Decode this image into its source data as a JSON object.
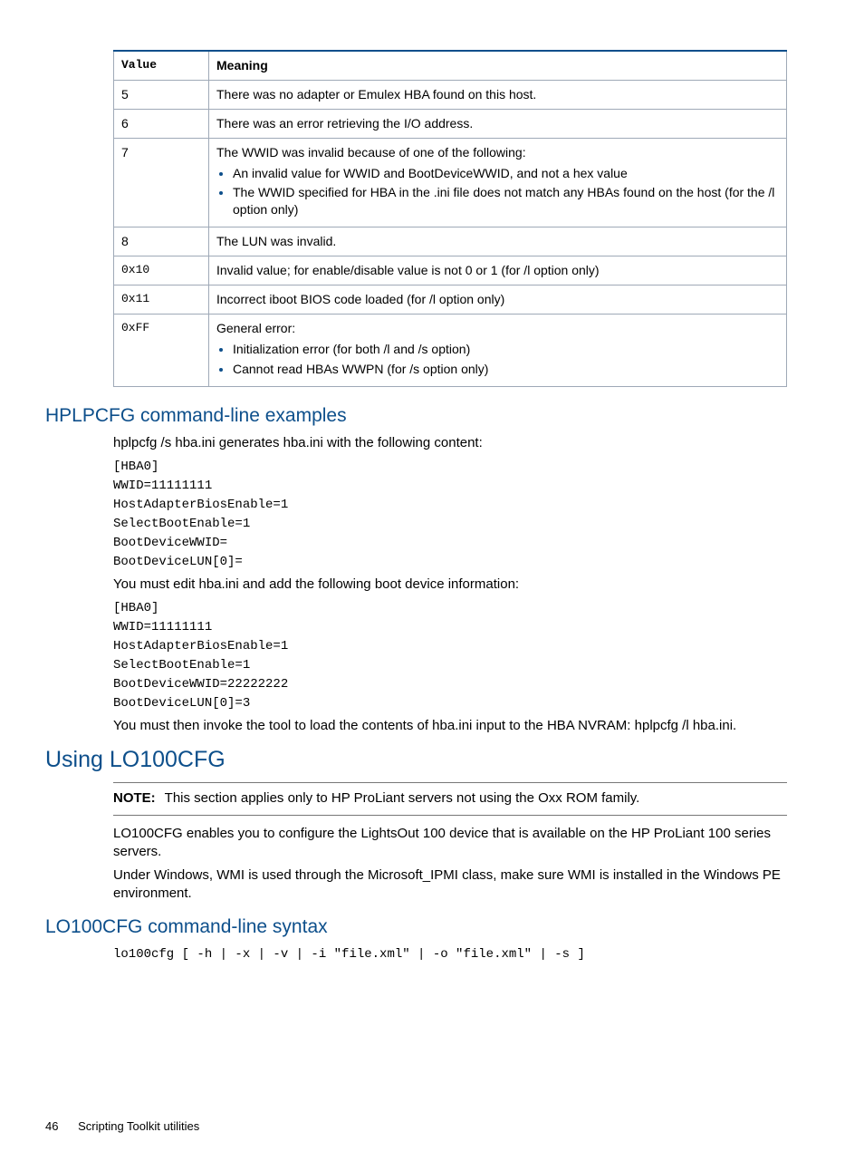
{
  "table": {
    "headers": {
      "value": "Value",
      "meaning": "Meaning"
    },
    "rows": [
      {
        "value": "5",
        "plain": true,
        "meaning": "There was no adapter or Emulex HBA found on this host."
      },
      {
        "value": "6",
        "plain": true,
        "meaning": "There was an error retrieving the I/O address."
      },
      {
        "value": "7",
        "plain": true,
        "meaning": "The WWID was invalid because of one of the following:",
        "bullets": [
          "An invalid value for WWID and BootDeviceWWID, and not a hex value",
          "The WWID specified for HBA in the .ini file does not match any HBAs found on the host (for the /l option only)"
        ]
      },
      {
        "value": "8",
        "plain": true,
        "meaning": "The LUN was invalid."
      },
      {
        "value": "0x10",
        "plain": false,
        "meaning": "Invalid value; for enable/disable value is not 0 or 1 (for /l option only)"
      },
      {
        "value": "0x11",
        "plain": false,
        "meaning": "Incorrect iboot BIOS code loaded (for /l option only)"
      },
      {
        "value": "0xFF",
        "plain": false,
        "meaning": "General error:",
        "bullets": [
          "Initialization error (for both /l and /s option)",
          "Cannot read HBAs WWPN (for /s option only)"
        ]
      }
    ]
  },
  "sec1": {
    "heading": "HPLPCFG command-line examples",
    "p1": "hplpcfg /s hba.ini generates hba.ini with the following content:",
    "code1": "[HBA0]\nWWID=11111111\nHostAdapterBiosEnable=1\nSelectBootEnable=1\nBootDeviceWWID=\nBootDeviceLUN[0]=",
    "p2": "You must edit hba.ini and add the following boot device information:",
    "code2": "[HBA0]\nWWID=11111111\nHostAdapterBiosEnable=1\nSelectBootEnable=1\nBootDeviceWWID=22222222\nBootDeviceLUN[0]=3",
    "p3": "You must then invoke the tool to load the contents of hba.ini input to the HBA NVRAM: hplpcfg /l hba.ini."
  },
  "sec2": {
    "heading": "Using LO100CFG",
    "note_label": "NOTE:",
    "note_text": "This section applies only to HP ProLiant servers not using the Oxx ROM family.",
    "p1": "LO100CFG enables you to configure the LightsOut 100 device that is available on the HP ProLiant 100 series servers.",
    "p2": "Under Windows, WMI is used through the Microsoft_IPMI class, make sure WMI is installed in the Windows PE environment."
  },
  "sec3": {
    "heading": "LO100CFG command-line syntax",
    "code": "lo100cfg [ -h | -x | -v | -i \"file.xml\" | -o \"file.xml\" | -s ]"
  },
  "footer": {
    "page": "46",
    "title": "Scripting Toolkit utilities"
  }
}
